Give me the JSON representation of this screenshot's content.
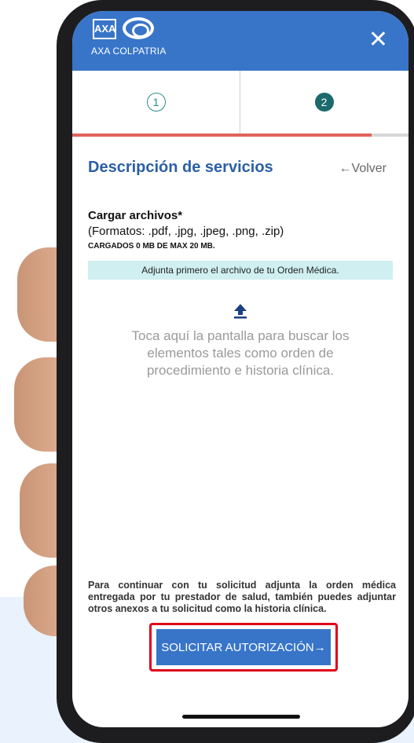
{
  "brand": {
    "name": "AXA COLPATRIA",
    "logo_mark": "AXA"
  },
  "header": {
    "close_icon": "close-icon"
  },
  "steps": [
    {
      "number": "1"
    },
    {
      "number": "2"
    }
  ],
  "progress_fraction": 0.89,
  "page": {
    "title": "Descripción de servicios",
    "back_label": "←Volver"
  },
  "upload": {
    "title": "Cargar archivos*",
    "formats": "(Formatos: .pdf, .jpg, .jpeg, .png, .zip)",
    "loaded": "CARGADOS 0 MB DE MAX 20 MB.",
    "notice": "Adjunta primero el archivo de tu Orden Médica.",
    "drop_text": "Toca aquí la pantalla para buscar los elementos tales como orden de procedimiento e historia clínica."
  },
  "footer": {
    "info": "Para continuar con tu solicitud adjunta la orden médica entregada por tu prestador de salud, también puedes adjuntar otros anexos a tu solicitud como la historia clínica.",
    "cta_label": "SOLICITAR AUTORIZACIÓN→"
  },
  "colors": {
    "header": "#3875c9",
    "accent": "#e0625a",
    "highlight": "#e0001b",
    "notice_bg": "#d0eff1"
  }
}
